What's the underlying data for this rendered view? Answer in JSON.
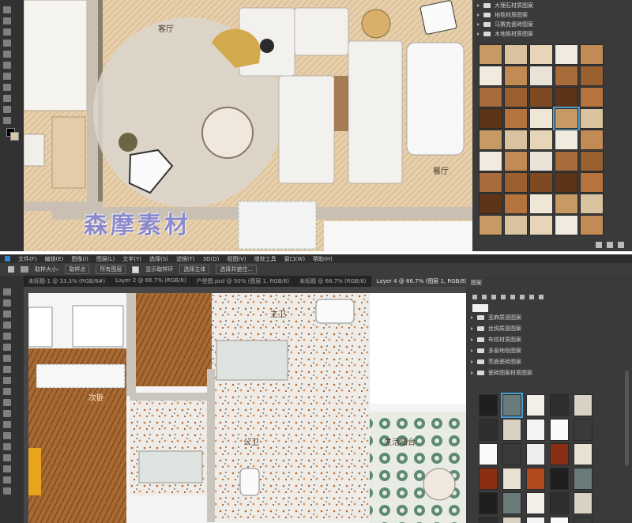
{
  "top": {
    "room_labels": {
      "living": "客厅",
      "dining": "餐厅"
    },
    "watermark": "森摩素材",
    "material_panel": {
      "folders": [
        "大理石材质图案",
        "地毯材质图案",
        "马赛克瓷砖图案",
        "木地板材质图案"
      ]
    }
  },
  "bottom": {
    "menubar": [
      "文件(F)",
      "编辑(E)",
      "图像(I)",
      "图层(L)",
      "文字(Y)",
      "选择(S)",
      "滤镜(T)",
      "3D(D)",
      "视图(V)",
      "增效工具",
      "窗口(W)",
      "帮助(H)"
    ],
    "options_bar": {
      "sample_label": "取样大小:",
      "sample_value": "取样点",
      "sample_mode": "所有图层",
      "show_ring": "显示取样环",
      "btn_select_subject": "选择主体",
      "btn_select_mask": "选择并遮住..."
    },
    "tabs": [
      {
        "label": "未标题-1 @ 33.3% (RGB/8#)",
        "active": false
      },
      {
        "label": "Layer 2 @ 66.7% (RGB/8)",
        "active": false
      },
      {
        "label": "户型图.psd @ 50% (图层 1, RGB/8)",
        "active": false
      },
      {
        "label": "未标题 @ 66.7% (RGB/8)",
        "active": false
      },
      {
        "label": "Layer 4 @ 66.7% (图层 1, RGB/8)",
        "active": true
      }
    ],
    "panel_title": "图案",
    "folders": [
      "亚麻质感图案",
      "丝绸质感图案",
      "布纹材质图案",
      "多层地毯图案",
      "亮面瓷砖图案",
      "瓷砖图案材质图案"
    ],
    "room_labels": {
      "bath": "主卫",
      "bedroom": "次卧",
      "wash": "公卫",
      "balcony": "生活阳台"
    }
  },
  "colors": {
    "accent_select": "#4a9ed6",
    "watermark": "#7d7fd2"
  }
}
